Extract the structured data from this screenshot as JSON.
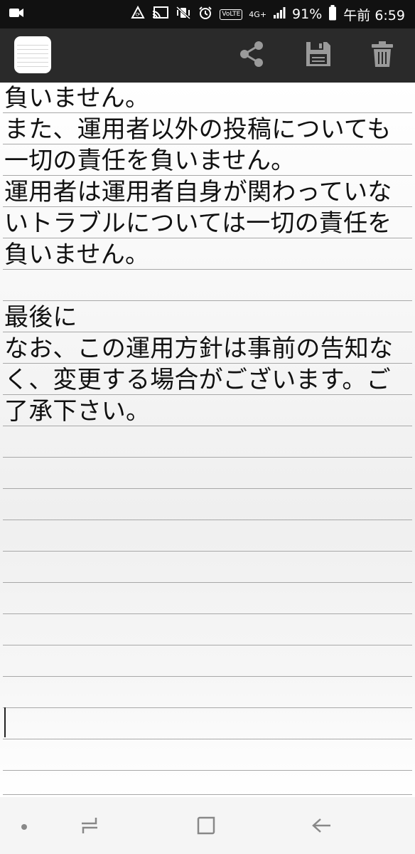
{
  "status_bar": {
    "battery_percent": "91%",
    "time": "午前 6:59",
    "network": "4G+",
    "volte": "VoLTE",
    "icons": [
      "screen-record-icon",
      "sync-icon",
      "cast-icon",
      "vibrate-mute-icon",
      "alarm-icon",
      "volte-icon",
      "network-4g-icon",
      "signal-icon",
      "battery-icon"
    ]
  },
  "app_bar": {
    "actions": [
      "share-icon",
      "save-icon",
      "delete-icon"
    ]
  },
  "note": {
    "lines": [
      "負いません。",
      "また、運用者以外の投稿についても",
      "一切の責任を負いません。",
      "運用者は運用者自身が関わっていな",
      "いトラブルについては一切の責任を",
      "負いません。",
      "",
      "最後に",
      "なお、この運用方針は事前の告知な",
      "く、変更する場合がございます。ご",
      "了承下さい。"
    ]
  },
  "nav_bar": {
    "buttons": [
      "home-dot-icon",
      "recents-icon",
      "overview-icon",
      "back-icon"
    ]
  }
}
